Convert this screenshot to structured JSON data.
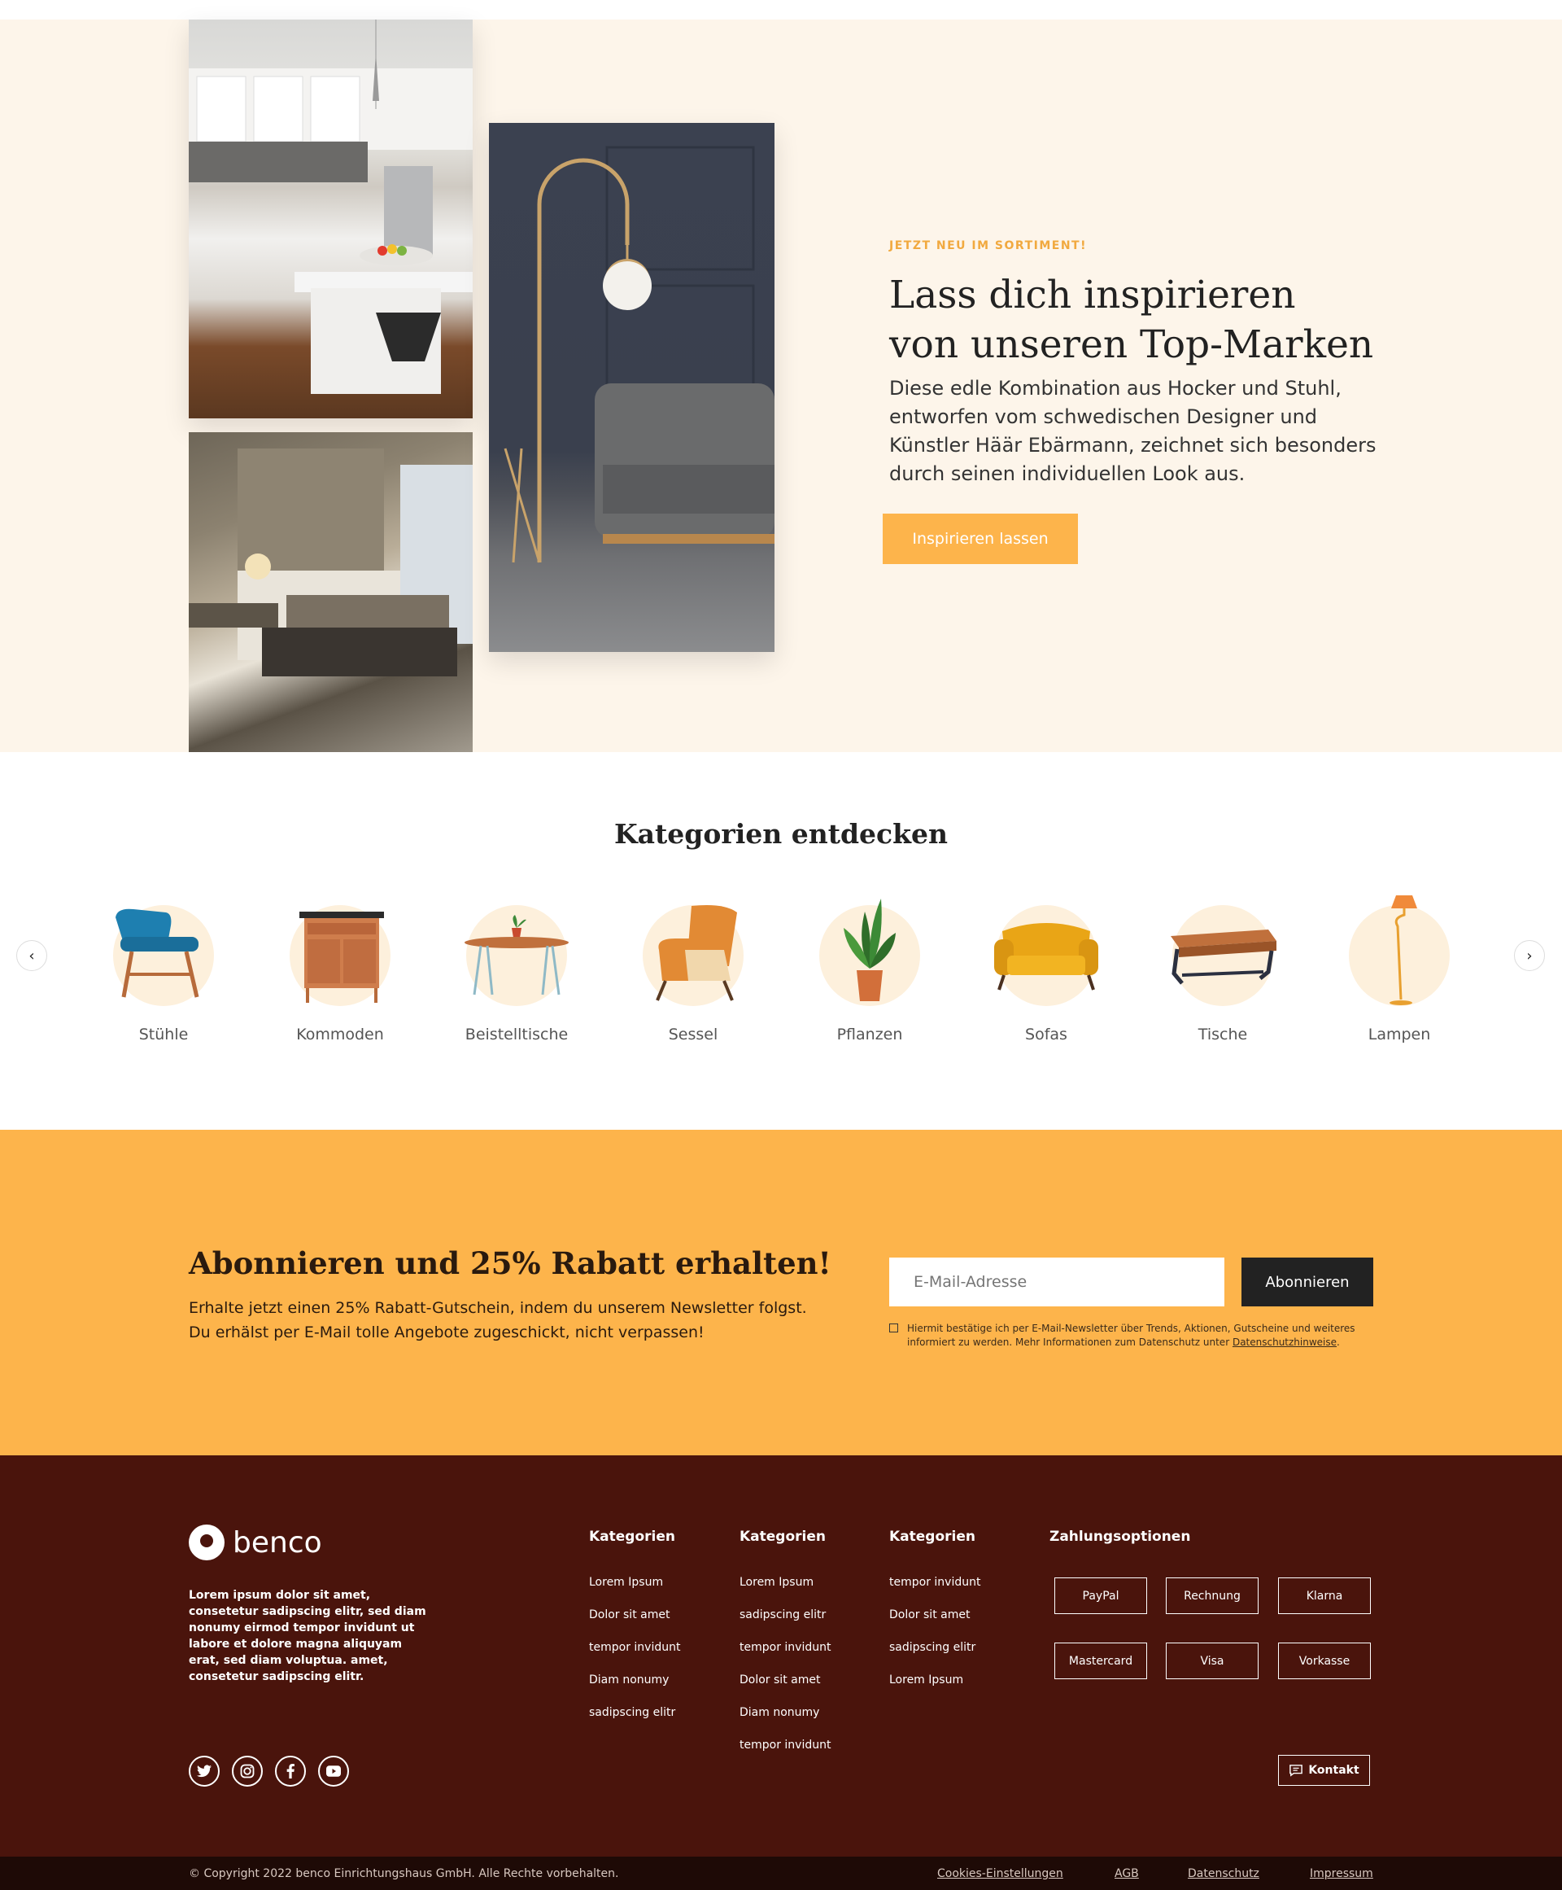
{
  "hero": {
    "eyebrow": "JETZT NEU IM SORTIMENT!",
    "title_line1": "Lass dich inspirieren",
    "title_line2": "von unseren Top-Marken",
    "description": "Diese edle Kombination aus Hocker und Stuhl, entworfen vom schwedischen Designer und Künstler Häär Ebärmann, zeichnet sich besonders durch seinen individuellen Look aus.",
    "button_label": "Inspirieren lassen"
  },
  "categories": {
    "title": "Kategorien entdecken",
    "prev_icon": "chevron-left-icon",
    "next_icon": "chevron-right-icon",
    "items": [
      {
        "label": "Stühle",
        "icon": "chair-icon"
      },
      {
        "label": "Kommoden",
        "icon": "dresser-icon"
      },
      {
        "label": "Beistelltische",
        "icon": "side-table-icon"
      },
      {
        "label": "Sessel",
        "icon": "armchair-icon"
      },
      {
        "label": "Pflanzen",
        "icon": "plant-icon"
      },
      {
        "label": "Sofas",
        "icon": "sofa-icon"
      },
      {
        "label": "Tische",
        "icon": "table-icon"
      },
      {
        "label": "Lampen",
        "icon": "lamp-icon"
      }
    ]
  },
  "newsletter": {
    "title": "Abonnieren und 25% Rabatt erhalten!",
    "description_line1": "Erhalte jetzt einen 25% Rabatt-Gutschein, indem du unserem Newsletter folgst.",
    "description_line2": "Du erhälst per E-Mail tolle Angebote zugeschickt, nicht verpassen!",
    "email_placeholder": "E-Mail-Adresse",
    "button_label": "Abonnieren",
    "consent_text": "Hiermit bestätige ich per E-Mail-Newsletter über Trends, Aktionen, Gutscheine und weiteres informiert zu werden. Mehr Informationen zum Datenschutz unter",
    "consent_link": "Datenschutzhinweise",
    "consent_end": "."
  },
  "footer": {
    "brand": "benco",
    "about": "Lorem ipsum dolor sit amet, consetetur sadipscing elitr, sed diam nonumy eirmod tempor invidunt ut labore et dolore magna aliquyam erat, sed diam voluptua.  amet, consetetur sadipscing elitr.",
    "columns": [
      {
        "title": "Kategorien",
        "links": [
          "Lorem Ipsum",
          "Dolor sit amet",
          "tempor invidunt",
          "Diam nonumy",
          "sadipscing elitr"
        ]
      },
      {
        "title": "Kategorien",
        "links": [
          "Lorem Ipsum",
          "sadipscing elitr",
          "tempor invidunt",
          "Dolor sit amet",
          "Diam nonumy",
          "tempor invidunt"
        ]
      },
      {
        "title": "Kategorien",
        "links": [
          "tempor invidunt",
          "Dolor sit amet",
          "sadipscing elitr",
          "Lorem Ipsum"
        ]
      }
    ],
    "payment_title": "Zahlungsoptionen",
    "payments": [
      "PayPal",
      "Rechnung",
      "Klarna",
      "Mastercard",
      "Visa",
      "Vorkasse"
    ],
    "social": [
      "twitter-icon",
      "instagram-icon",
      "facebook-icon",
      "youtube-icon"
    ],
    "contact_label": "Kontakt",
    "copyright": "© Copyright 2022 benco Einrichtungshaus GmbH. Alle Rechte vorbehalten.",
    "bottom_links": [
      "Cookies-Einstellungen",
      "AGB",
      "Datenschutz",
      "Impressum"
    ]
  },
  "colors": {
    "accent": "#fdb44b",
    "hero_bg": "#fdf5ea",
    "footer_bg": "#4a140c",
    "bottom_bar": "#1e0a06"
  }
}
